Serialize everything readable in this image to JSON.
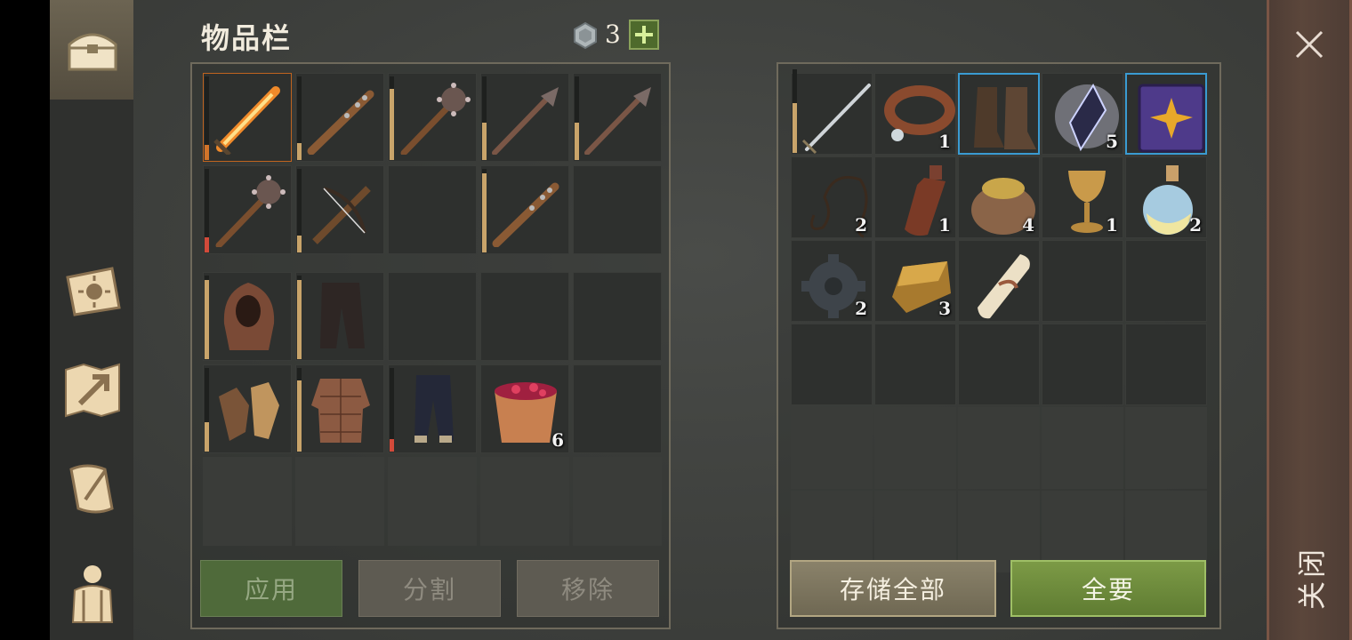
{
  "inventory": {
    "title": "物品栏",
    "currency_amount": "3"
  },
  "buttons": {
    "apply": "应用",
    "split": "分割",
    "remove": "移除",
    "store_all": "存储全部",
    "take_all": "全要",
    "close": "关闭"
  },
  "left_weapons": [
    {
      "name": "fire-sword-icon",
      "dura": 0.18,
      "dura_color": "#d2742a",
      "count": ""
    },
    {
      "name": "spiked-club-icon",
      "dura": 0.2,
      "dura_color": "#c9a46a",
      "count": ""
    },
    {
      "name": "morning-star-icon",
      "dura": 0.85,
      "dura_color": "#c9a46a",
      "count": ""
    },
    {
      "name": "mace-icon",
      "dura": 0.45,
      "dura_color": "#c9a46a",
      "count": ""
    },
    {
      "name": "mace-icon",
      "dura": 0.45,
      "dura_color": "#c9a46a",
      "count": ""
    },
    {
      "name": "morning-star-icon",
      "dura": 0.18,
      "dura_color": "#d24a3a",
      "count": ""
    },
    {
      "name": "crossbow-icon",
      "dura": 0.2,
      "dura_color": "#c9a46a",
      "count": ""
    },
    {
      "name": "empty",
      "dura": 0,
      "dura_color": "",
      "count": ""
    },
    {
      "name": "spiked-club-icon",
      "dura": 0.95,
      "dura_color": "#c9a46a",
      "count": ""
    },
    {
      "name": "empty",
      "dura": 0,
      "dura_color": "",
      "count": ""
    }
  ],
  "left_gear": [
    {
      "name": "hood-icon",
      "dura": 0.95,
      "dura_color": "#c9a46a",
      "count": ""
    },
    {
      "name": "pants-icon",
      "dura": 0.95,
      "dura_color": "#c9a46a",
      "count": ""
    },
    {
      "name": "empty",
      "dura": 0,
      "dura_color": "",
      "count": ""
    },
    {
      "name": "empty",
      "dura": 0,
      "dura_color": "",
      "count": ""
    },
    {
      "name": "empty",
      "dura": 0,
      "dura_color": "",
      "count": ""
    },
    {
      "name": "gloves-icon",
      "dura": 0.35,
      "dura_color": "#c9a46a",
      "count": ""
    },
    {
      "name": "gambeson-icon",
      "dura": 0.85,
      "dura_color": "#c9a46a",
      "count": ""
    },
    {
      "name": "dark-pants-icon",
      "dura": 0.15,
      "dura_color": "#d24a3a",
      "count": ""
    },
    {
      "name": "berry-bucket-icon",
      "dura": 0,
      "dura_color": "",
      "count": "6"
    },
    {
      "name": "empty",
      "dura": 0,
      "dura_color": "",
      "count": ""
    }
  ],
  "right_items": [
    {
      "name": "sword-icon",
      "dura": 0.6,
      "dura_color": "#c9a46a",
      "count": "",
      "border": ""
    },
    {
      "name": "collar-icon",
      "dura": 0,
      "dura_color": "",
      "count": "1",
      "border": ""
    },
    {
      "name": "boots-icon",
      "dura": 0,
      "dura_color": "",
      "count": "",
      "border": "blue"
    },
    {
      "name": "crystal-icon",
      "dura": 0,
      "dura_color": "",
      "count": "5",
      "border": ""
    },
    {
      "name": "spellbook-icon",
      "dura": 0,
      "dura_color": "",
      "count": "",
      "border": "blue"
    },
    {
      "name": "rope-icon",
      "dura": 0,
      "dura_color": "",
      "count": "2",
      "border": ""
    },
    {
      "name": "bottle-icon",
      "dura": 0,
      "dura_color": "",
      "count": "1",
      "border": ""
    },
    {
      "name": "grain-sack-icon",
      "dura": 0,
      "dura_color": "",
      "count": "4",
      "border": ""
    },
    {
      "name": "goblet-icon",
      "dura": 0,
      "dura_color": "",
      "count": "1",
      "border": ""
    },
    {
      "name": "potion-icon",
      "dura": 0,
      "dura_color": "",
      "count": "2",
      "border": ""
    },
    {
      "name": "gear-icon",
      "dura": 0,
      "dura_color": "",
      "count": "2",
      "border": ""
    },
    {
      "name": "gold-ingot-icon",
      "dura": 0,
      "dura_color": "",
      "count": "3",
      "border": ""
    },
    {
      "name": "scroll-icon",
      "dura": 0,
      "dura_color": "",
      "count": "",
      "border": ""
    }
  ]
}
